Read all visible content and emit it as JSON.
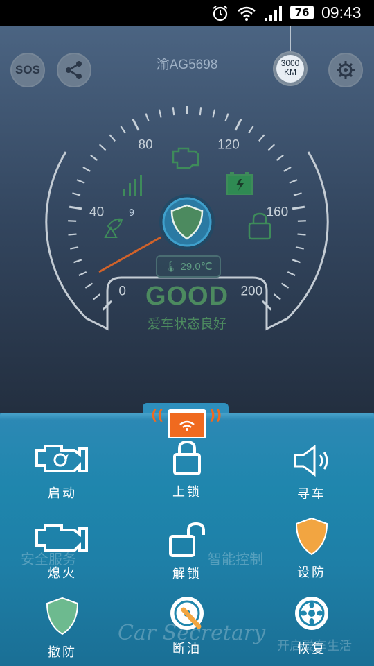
{
  "status_bar": {
    "battery": "76",
    "time": "09:43"
  },
  "header": {
    "sos_label": "SOS",
    "plate": "渝AG5698",
    "mileage_value": "3000",
    "mileage_unit": "KM"
  },
  "gauge": {
    "ticks": [
      "0",
      "40",
      "80",
      "120",
      "160",
      "200"
    ],
    "needle_value": 0,
    "satellite_count": "9",
    "temperature": "29.0℃",
    "status_title": "GOOD",
    "status_subtitle": "爱车状态良好"
  },
  "controls": [
    {
      "label": "启动",
      "icon": "engine-start-icon"
    },
    {
      "label": "上锁",
      "icon": "lock-icon"
    },
    {
      "label": "寻车",
      "icon": "speaker-icon"
    },
    {
      "label": "熄火",
      "icon": "engine-off-icon"
    },
    {
      "label": "解锁",
      "icon": "unlock-icon"
    },
    {
      "label": "设防",
      "icon": "shield-orange-icon"
    },
    {
      "label": "撤防",
      "icon": "shield-green-icon"
    },
    {
      "label": "断油",
      "icon": "fuel-cut-icon"
    },
    {
      "label": "恢复",
      "icon": "wheel-icon"
    }
  ],
  "background_menu": {
    "safety": "安全服务",
    "smart": "智能控制",
    "life": "开启爱车生活",
    "brand": "Car Secretary"
  },
  "colors": {
    "accent_green": "#4c8a5f",
    "panel_blue": "#1f86ad",
    "orange": "#f06a1f"
  }
}
